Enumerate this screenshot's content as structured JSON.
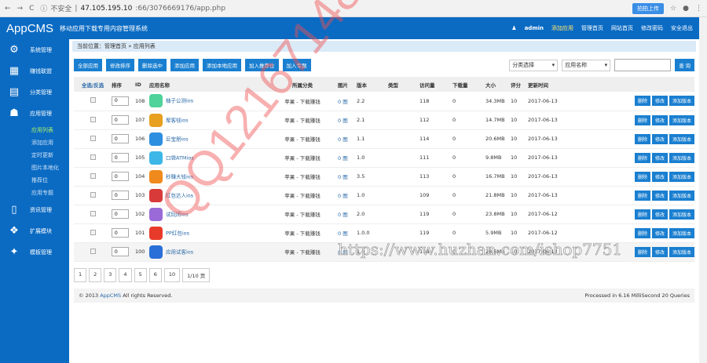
{
  "browser": {
    "insecure": "不安全",
    "url_host": "47.105.195.10",
    "url_path": ":66/3076669176/app.php",
    "ext_label": "拍拍上传"
  },
  "header": {
    "logo": "AppCMS",
    "subtitle": "移动应用下载专用内容管理系统",
    "user": "admin",
    "nav": [
      "添加应用",
      "管理首页",
      "网站首页",
      "修改密码",
      "安全退出"
    ]
  },
  "sidebar": {
    "items": [
      {
        "label": "系统管理",
        "icon": "⚙"
      },
      {
        "label": "赚钱联盟",
        "icon": "▦"
      },
      {
        "label": "分类管理",
        "icon": "▤"
      },
      {
        "label": "应用管理",
        "icon": "☗"
      }
    ],
    "sub": [
      "应用列表",
      "添加应用",
      "定时更新",
      "图片本地化",
      "推荐位",
      "应用专题"
    ],
    "items2": [
      {
        "label": "资讯管理",
        "icon": "▯"
      },
      {
        "label": "扩展模块",
        "icon": "❖"
      },
      {
        "label": "模板管理",
        "icon": "✦"
      }
    ]
  },
  "breadcrumb": "当前位置：管理首页 » 应用列表",
  "toolbar": {
    "buttons": [
      "全部应用",
      "修改排序",
      "删除选中",
      "添加应用",
      "添加本地应用",
      "加入推荐位",
      "加入专题"
    ],
    "category_select": "分类选择",
    "field_select": "应用名称",
    "search_value": "",
    "search_label": "查 询"
  },
  "table": {
    "headers": [
      "全选/反选",
      "排序",
      "ID",
      "应用名称",
      "所属分类",
      "图片",
      "版本",
      "类型",
      "访问量",
      "下载量",
      "大小",
      "评分",
      "更新时间"
    ],
    "actions": [
      "删除",
      "修改",
      "添加版本"
    ],
    "rows": [
      {
        "order": "0",
        "id": "108",
        "name": "柚子公测ios",
        "category": "苹果 - 下载赚钱",
        "pics": "0 图",
        "version": "2.2",
        "type": "",
        "visits": "118",
        "downloads": "0",
        "size": "34.3MB",
        "score": "10",
        "date": "2017-06-13",
        "color": "#4fd39a"
      },
      {
        "order": "0",
        "id": "107",
        "name": "聚客钱ios",
        "category": "苹果 - 下载赚钱",
        "pics": "0 图",
        "version": "2.1",
        "type": "",
        "visits": "112",
        "downloads": "0",
        "size": "14.7MB",
        "score": "10",
        "date": "2017-06-13",
        "color": "#e8a020"
      },
      {
        "order": "0",
        "id": "106",
        "name": "巨宝朋ios",
        "category": "苹果 - 下载赚钱",
        "pics": "0 图",
        "version": "1.1",
        "type": "",
        "visits": "114",
        "downloads": "0",
        "size": "20.6MB",
        "score": "10",
        "date": "2017-06-13",
        "color": "#2d8fe0"
      },
      {
        "order": "0",
        "id": "105",
        "name": "口袋ATMios",
        "category": "苹果 - 下载赚钱",
        "pics": "0 图",
        "version": "1.0",
        "type": "",
        "visits": "111",
        "downloads": "0",
        "size": "9.8MB",
        "score": "10",
        "date": "2017-06-13",
        "color": "#3cb7e8"
      },
      {
        "order": "0",
        "id": "104",
        "name": "秒赚大钱ios",
        "category": "苹果 - 下载赚钱",
        "pics": "0 图",
        "version": "3.5",
        "type": "",
        "visits": "113",
        "downloads": "0",
        "size": "16.7MB",
        "score": "10",
        "date": "2017-06-13",
        "color": "#f08a1c"
      },
      {
        "order": "0",
        "id": "103",
        "name": "红包达人ios",
        "category": "苹果 - 下载赚钱",
        "pics": "0 图",
        "version": "1.0",
        "type": "",
        "visits": "109",
        "downloads": "0",
        "size": "21.8MB",
        "score": "10",
        "date": "2017-06-13",
        "color": "#d83a3a"
      },
      {
        "order": "0",
        "id": "102",
        "name": "试玩团ios",
        "category": "苹果 - 下载赚钱",
        "pics": "0 图",
        "version": "2.0",
        "type": "",
        "visits": "119",
        "downloads": "0",
        "size": "23.8MB",
        "score": "10",
        "date": "2017-06-12",
        "color": "#9a6ad8"
      },
      {
        "order": "0",
        "id": "101",
        "name": "PP红包ios",
        "category": "苹果 - 下载赚钱",
        "pics": "0 图",
        "version": "1.0.0",
        "type": "",
        "visits": "119",
        "downloads": "0",
        "size": "5.9MB",
        "score": "10",
        "date": "2017-06-12",
        "color": "#e83a2a"
      },
      {
        "order": "0",
        "id": "100",
        "name": "应用试客ios",
        "category": "苹果 - 下载赚钱",
        "pics": "0 图",
        "version": "1.0",
        "type": "",
        "visits": "116",
        "downloads": "0",
        "size": "28.6MB",
        "score": "10",
        "date": "2017-06-12",
        "color": "#2a6fd8"
      }
    ]
  },
  "pagination": [
    "1",
    "2",
    "3",
    "4",
    "5",
    "6",
    "10",
    "1/10 页"
  ],
  "footer": {
    "copyright_pre": "© 2013 ",
    "brand": "AppCMS",
    "copyright_post": " All rights Reserved.",
    "stats": "Processed in 6.16 MilliSecond 20 Queries"
  },
  "watermarks": [
    "QQ1216714825",
    "https://www.huzhan.com/ishop7751"
  ]
}
